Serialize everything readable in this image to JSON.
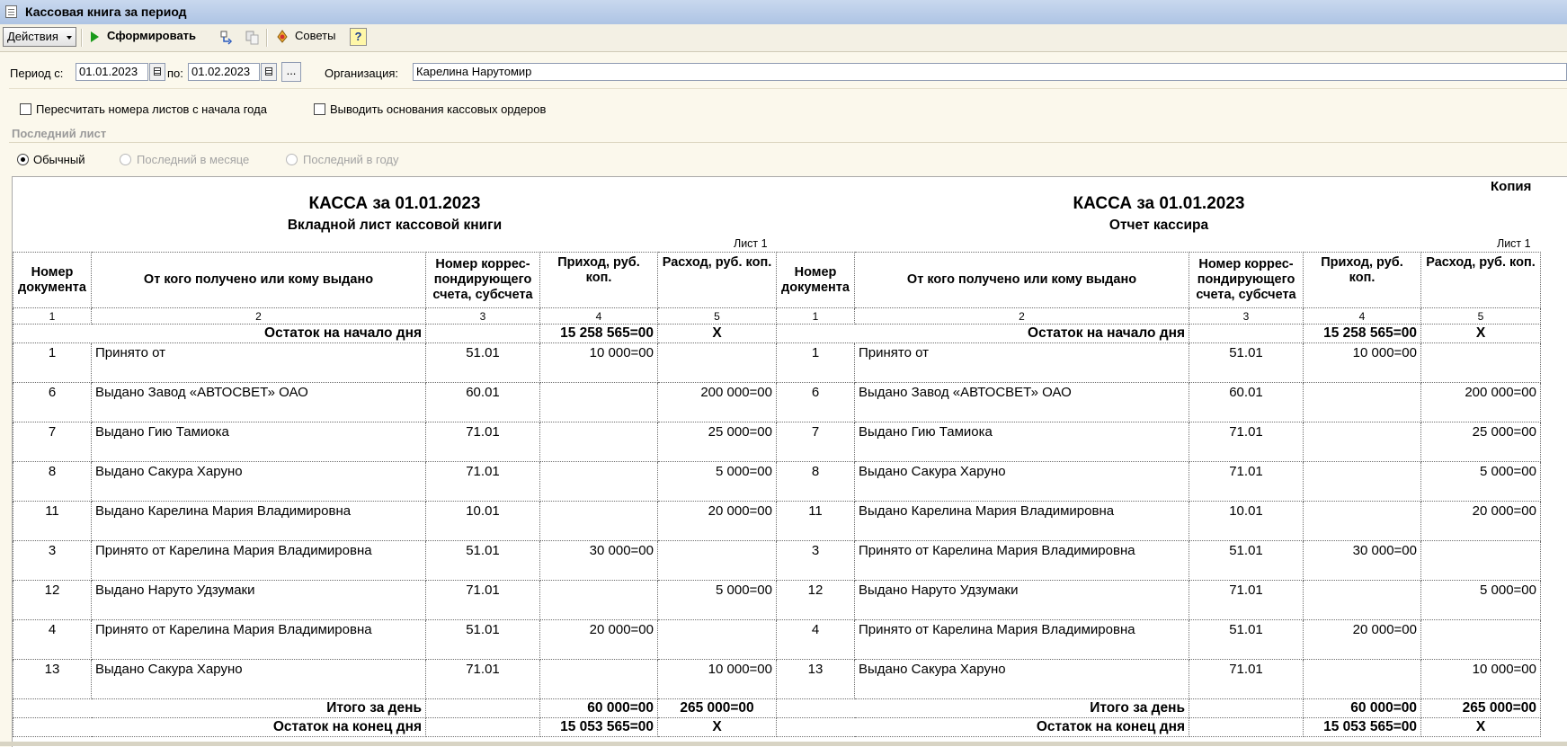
{
  "window": {
    "title": "Кассовая книга за период"
  },
  "toolbar": {
    "actions": "Действия",
    "generate": "Сформировать",
    "tips": "Советы",
    "help": "?"
  },
  "filters": {
    "period_from_label": "Период с:",
    "period_from": "01.01.2023",
    "period_to_label": "по:",
    "period_to": "01.02.2023",
    "dots": "...",
    "org_label": "Организация:",
    "org": "Карелина Нарутомир"
  },
  "options": {
    "recalc": "Пересчитать номера листов с начала года",
    "show_basis": "Выводить основания кассовых ордеров",
    "last_sheet_title": "Последний лист",
    "radio_normal": "Обычный",
    "radio_month": "Последний в месяце",
    "radio_year": "Последний в году"
  },
  "report": {
    "copy_label": "Копия",
    "left": {
      "title": "КАССА за 01.01.2023",
      "subtitle": "Вкладной лист кассовой книги",
      "sheet": "Лист 1"
    },
    "right": {
      "title": "КАССА за 01.01.2023",
      "subtitle": "Отчет кассира",
      "sheet": "Лист 1"
    },
    "headers": [
      "Номер документа",
      "От кого получено или кому выдано",
      "Номер коррес-пондирующего счета, субсчета",
      "Приход, руб. коп.",
      "Расход, руб. коп."
    ],
    "col_numbers": [
      "1",
      "2",
      "3",
      "4",
      "5"
    ],
    "opening": {
      "label": "Остаток на начало дня",
      "income": "15 258 565=00",
      "expense": "X"
    },
    "rows": [
      {
        "doc": "1",
        "who": "Принято от",
        "acc": "51.01",
        "income": "10 000=00",
        "expense": ""
      },
      {
        "doc": "6",
        "who": "Выдано Завод «АВТОСВЕТ» ОАО",
        "acc": "60.01",
        "income": "",
        "expense": "200 000=00"
      },
      {
        "doc": "7",
        "who": "Выдано Гию Тамиока",
        "acc": "71.01",
        "income": "",
        "expense": "25 000=00"
      },
      {
        "doc": "8",
        "who": "Выдано Сакура Харуно",
        "acc": "71.01",
        "income": "",
        "expense": "5 000=00"
      },
      {
        "doc": "11",
        "who": "Выдано Карелина Мария Владимировна",
        "acc": "10.01",
        "income": "",
        "expense": "20 000=00"
      },
      {
        "doc": "3",
        "who": "Принято от Карелина Мария Владимировна",
        "acc": "51.01",
        "income": "30 000=00",
        "expense": ""
      },
      {
        "doc": "12",
        "who": "Выдано Наруто Удзумаки",
        "acc": "71.01",
        "income": "",
        "expense": "5 000=00"
      },
      {
        "doc": "4",
        "who": "Принято от Карелина Мария Владимировна",
        "acc": "51.01",
        "income": "20 000=00",
        "expense": ""
      },
      {
        "doc": "13",
        "who": "Выдано Сакура Харуно",
        "acc": "71.01",
        "income": "",
        "expense": "10 000=00"
      }
    ],
    "day_total": {
      "label": "Итого за день",
      "income": "60 000=00",
      "expense": "265 000=00"
    },
    "closing": {
      "label": "Остаток на конец  дня",
      "income": "15 053 565=00",
      "expense": "X"
    }
  }
}
